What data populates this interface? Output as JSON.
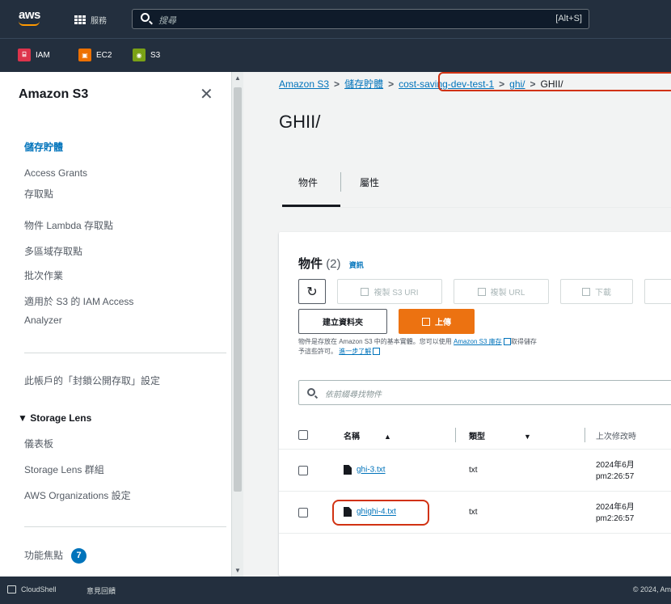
{
  "topnav": {
    "logo": "aws",
    "services_label": "服務",
    "search_placeholder": "搜尋",
    "search_shortcut": "[Alt+S]"
  },
  "favorites": [
    {
      "label": "IAM",
      "color": "#dd344c",
      "icon": "iam-icon"
    },
    {
      "label": "EC2",
      "color": "#ed7100",
      "icon": "ec2-icon"
    },
    {
      "label": "S3",
      "color": "#7aa116",
      "icon": "s3-icon"
    }
  ],
  "sidebar": {
    "title": "Amazon S3",
    "items": [
      {
        "label": "儲存貯體",
        "active": true
      },
      {
        "label": "Access Grants",
        "active": false
      },
      {
        "label": "存取點",
        "active": false
      },
      {
        "label": "物件 Lambda 存取點",
        "active": false
      },
      {
        "label": "多區域存取點",
        "active": false
      },
      {
        "label": "批次作業",
        "active": false
      },
      {
        "label": "適用於 S3 的 IAM Access",
        "active": false
      },
      {
        "label": "Analyzer",
        "active": false
      }
    ],
    "block_public": "此帳戶的「封鎖公開存取」設定",
    "storage_lens": {
      "title": "Storage Lens",
      "items": [
        "儀表板",
        "Storage Lens 群組",
        "AWS Organizations 設定"
      ]
    },
    "feature_spotlight": "功能焦點",
    "feature_badge": "7"
  },
  "breadcrumb": {
    "items": [
      "Amazon S3",
      "儲存貯體",
      "cost-saving-dev-test-1",
      "ghi/"
    ],
    "current": "GHII/"
  },
  "page": {
    "title": "GHII/",
    "tabs": [
      "物件",
      "屬性"
    ]
  },
  "objects": {
    "title": "物件",
    "count": "(2)",
    "info": "資訊",
    "buttons": {
      "copy_s3_uri": "複製 S3 URI",
      "copy_url": "複製 URL",
      "download": "下載",
      "create_folder": "建立資料夾",
      "upload": "上傳"
    },
    "help_text": "物件是存放在 Amazon S3 中的基本實體。您可以使用",
    "help_link": "Amazon S3 庫存",
    "help_text2": "取得儲存",
    "help_text3": "予這些許可。",
    "help_link2": "進一步了解",
    "filter_placeholder": "依前綴尋找物件",
    "columns": {
      "name": "名稱",
      "type": "類型",
      "modified": "上次修改時"
    },
    "rows": [
      {
        "name": "ghi-3.txt",
        "type": "txt",
        "date": "2024年6月",
        "time": "pm2:26:57"
      },
      {
        "name": "ghighi-4.txt",
        "type": "txt",
        "date": "2024年6月",
        "time": "pm2:26:57"
      }
    ]
  },
  "footer": {
    "cloudshell": "CloudShell",
    "feedback": "意見回饋",
    "copyright": "© 2024, Am"
  }
}
